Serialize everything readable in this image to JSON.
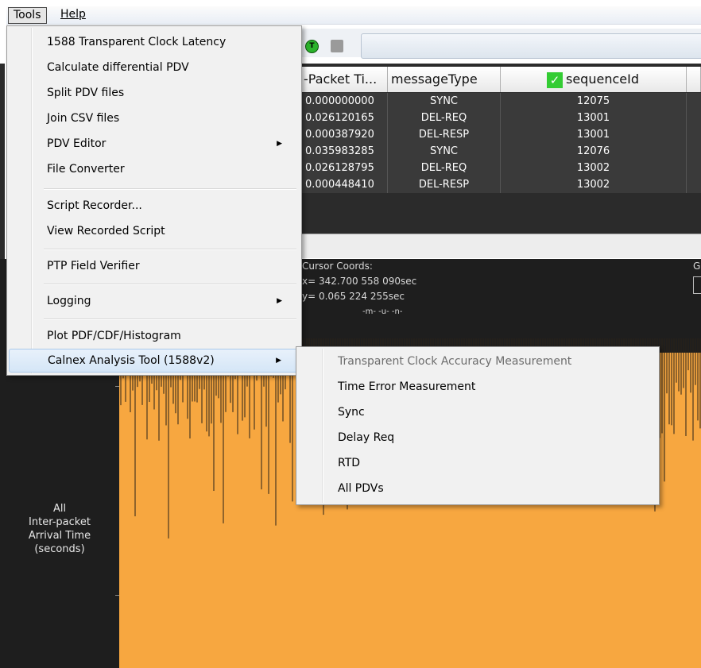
{
  "menubar": {
    "tools": "Tools",
    "help": "Help"
  },
  "tools_menu": {
    "items": [
      {
        "label": "1588 Transparent Clock Latency"
      },
      {
        "label": "Calculate differential PDV"
      },
      {
        "label": "Split PDV files"
      },
      {
        "label": "Join CSV files"
      },
      {
        "label": "PDV Editor",
        "submenu": true
      },
      {
        "label": "File Converter"
      },
      {
        "label": "Script Recorder..."
      },
      {
        "label": "View Recorded Script"
      },
      {
        "label": "PTP Field Verifier"
      },
      {
        "label": "Logging",
        "submenu": true
      },
      {
        "label": "Plot PDF/CDF/Histogram"
      },
      {
        "label": "Calnex Analysis Tool (1588v2)",
        "submenu": true,
        "highlighted": true
      }
    ]
  },
  "calnex_submenu": {
    "items": [
      {
        "label": "Transparent Clock Accuracy Measurement",
        "disabled": true
      },
      {
        "label": "Time Error Measurement"
      },
      {
        "label": "Sync"
      },
      {
        "label": "Delay Req"
      },
      {
        "label": "RTD"
      },
      {
        "label": "All PDVs"
      }
    ]
  },
  "table": {
    "columns": [
      "-Packet Ti...",
      "messageType",
      "sequenceId"
    ],
    "rows": [
      [
        "0.000000000",
        "SYNC",
        "12075"
      ],
      [
        "0.026120165",
        "DEL-REQ",
        "13001"
      ],
      [
        "0.000387920",
        "DEL-RESP",
        "13001"
      ],
      [
        "0.035983285",
        "SYNC",
        "12076"
      ],
      [
        "0.026128795",
        "DEL-REQ",
        "13002"
      ],
      [
        "0.000448410",
        "DEL-RESP",
        "13002"
      ]
    ]
  },
  "cursor": {
    "title": "Cursor Coords:",
    "x": "x=   342.700 558 090sec",
    "y": "y=      0.065 224 255sec",
    "units": "-m-   -u-   -n-"
  },
  "plot": {
    "y_label_lines": [
      "All",
      "Inter-packet",
      "Arrival Time",
      "(seconds)"
    ],
    "fill_color": "#f7a740",
    "background_color": "#1e1e1e"
  },
  "right_edge_letter": "G",
  "colors": {
    "menu_bg": "#f1f1f1",
    "highlight": "#d5e6f7",
    "check_green": "#33cc33"
  }
}
